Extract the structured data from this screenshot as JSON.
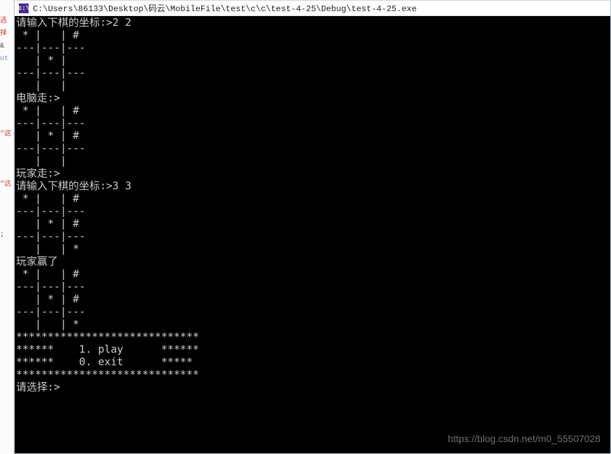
{
  "titlebar": {
    "icon_label": "C:\\",
    "path": "C:\\Users\\86133\\Desktop\\码云\\MobileFile\\test\\c\\c\\test-4-25\\Debug\\test-4-25.exe"
  },
  "gutter": {
    "t1": "选择",
    "t2": " &",
    "t3": "ut",
    "t4": "\"这",
    "t5": "\"这",
    "t6": ";"
  },
  "console_lines": {
    "l0": "请输入下棋的坐标:>2 2",
    "l1": " * |   | #",
    "l2": "---|---|---",
    "l3": "   | * |  ",
    "l4": "---|---|---",
    "l5": "   |   |  ",
    "l6": "电脑走:>",
    "l7": " * |   | #",
    "l8": "---|---|---",
    "l9": "   | * | #",
    "l10": "---|---|---",
    "l11": "   |   |  ",
    "l12": "玩家走:>",
    "l13": "请输入下棋的坐标:>3 3",
    "l14": " * |   | #",
    "l15": "---|---|---",
    "l16": "   | * | #",
    "l17": "---|---|---",
    "l18": "   |   | *",
    "l19": "玩家赢了",
    "l20": " * |   | #",
    "l21": "---|---|---",
    "l22": "   | * | #",
    "l23": "---|---|---",
    "l24": "   |   | *",
    "l25": "*****************************",
    "l26": "******    1. play      ******",
    "l27": "******    0. exit      *****",
    "l28": "*****************************",
    "l29": "请选择:>"
  },
  "watermark": "https://blog.csdn.net/m0_55507028"
}
